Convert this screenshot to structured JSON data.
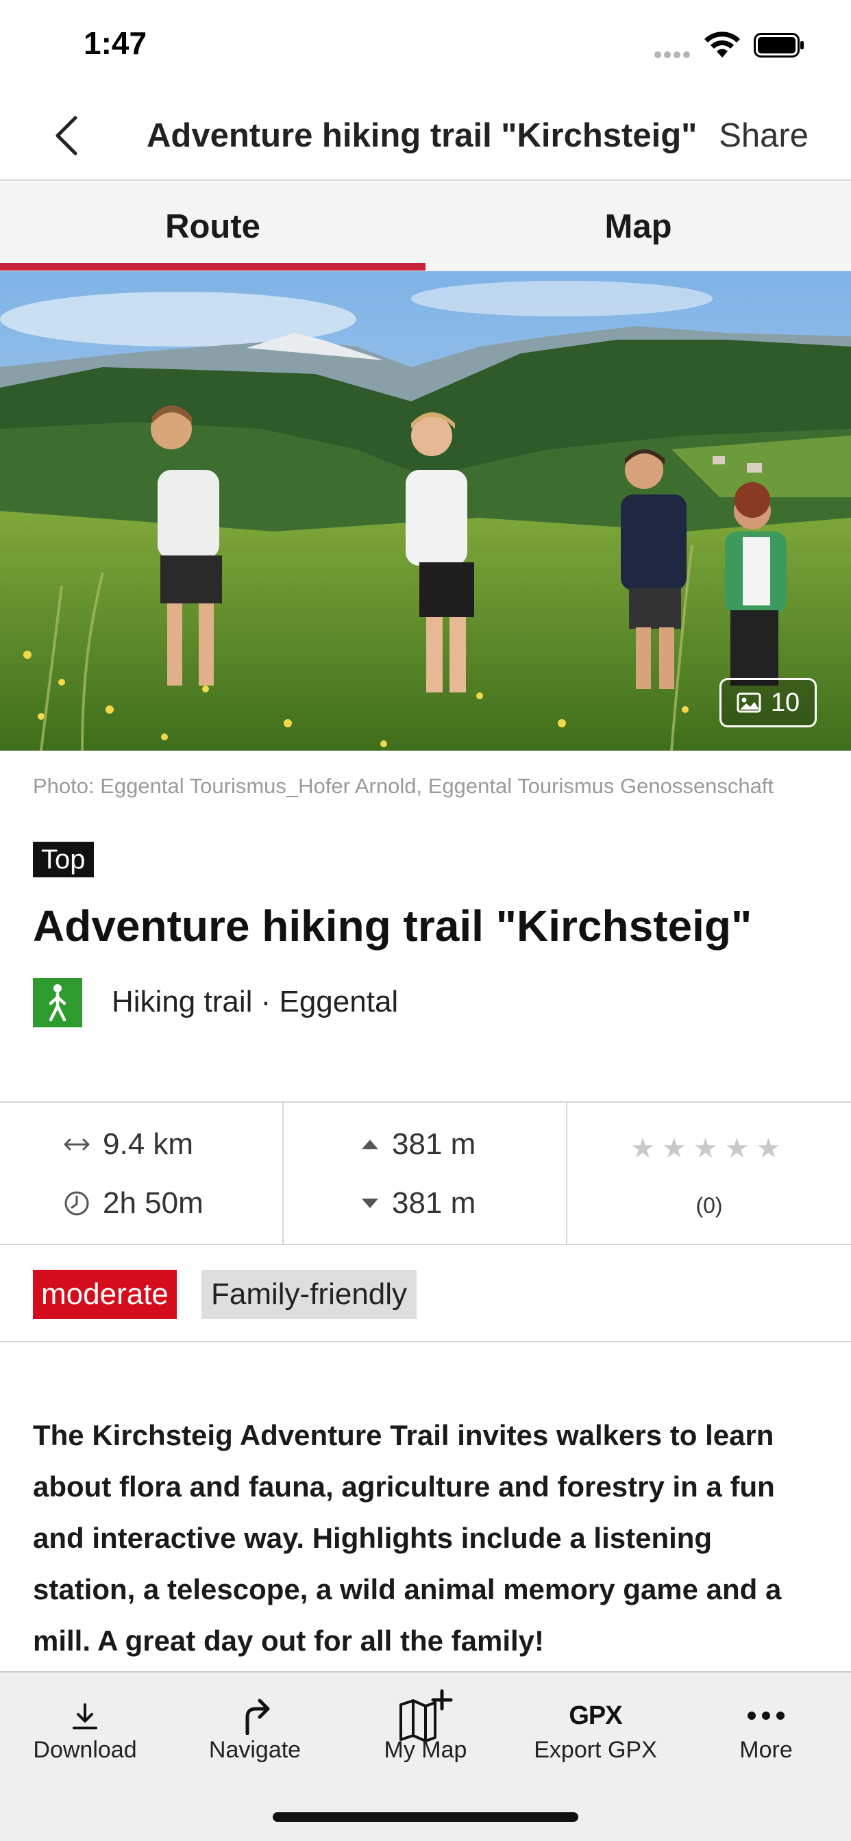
{
  "status_bar": {
    "time": "1:47"
  },
  "nav": {
    "title": "Adventure hiking trail \"Kirchsteig\"",
    "share_label": "Share"
  },
  "tabs": [
    {
      "label": "Route",
      "active": true
    },
    {
      "label": "Map",
      "active": false
    }
  ],
  "hero": {
    "photo_count": "10"
  },
  "photo_credit": "Photo: Eggental Tourismus_Hofer Arnold, Eggental Tourismus Genossenschaft",
  "badge": "Top",
  "trail": {
    "title": "Adventure hiking trail \"Kirchsteig\"",
    "subtitle": "Hiking trail · Eggental",
    "category_icon": "hiking-icon"
  },
  "stats": {
    "distance": "9.4 km",
    "duration": "2h 50m",
    "ascent": "381 m",
    "descent": "381 m",
    "rating_stars": "★★★★★",
    "rating_value": 0,
    "rating_count": "(0)"
  },
  "tags": {
    "difficulty": "moderate",
    "family": "Family-friendly"
  },
  "description": "The Kirchsteig Adventure Trail invites walkers to learn about flora and fauna, agriculture and forestry in a fun and interactive way. Highlights include a listening station, a telescope, a wild animal memory game and a mill. A great day out for all the family!",
  "toolbar": [
    {
      "label": "Download",
      "icon": "download-icon"
    },
    {
      "label": "Navigate",
      "icon": "navigate-icon"
    },
    {
      "label": "My Map",
      "icon": "my-map-icon"
    },
    {
      "label": "Export GPX",
      "icon": "gpx-icon",
      "icon_text": "GPX"
    },
    {
      "label": "More",
      "icon": "more-icon"
    }
  ],
  "colors": {
    "accent": "#c8203a",
    "difficulty": "#d40c1b",
    "hiking": "#2d9b2d"
  }
}
